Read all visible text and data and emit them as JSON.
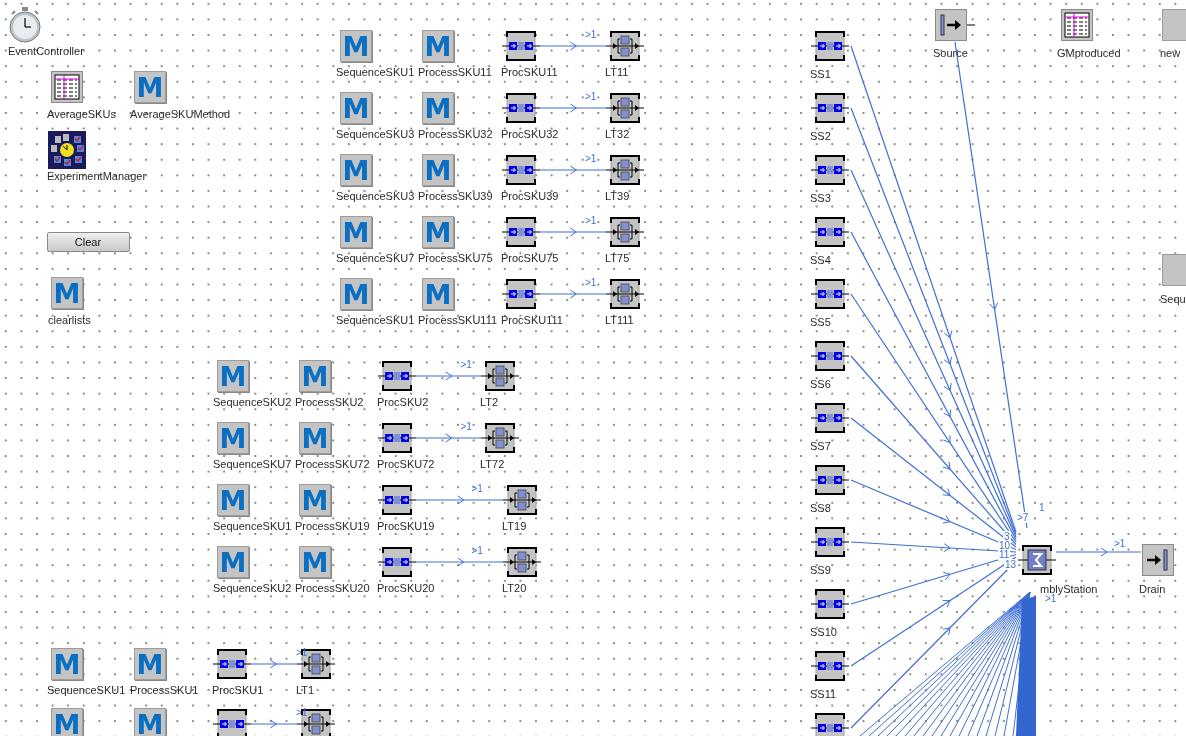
{
  "tools": [
    {
      "kind": "event_controller",
      "label": "EventController"
    },
    {
      "kind": "table",
      "label": "AverageSKUs"
    },
    {
      "kind": "method",
      "glyph": "M",
      "label": "AverageSKUMethod"
    },
    {
      "kind": "experiment_manager",
      "label": "ExperimentManager"
    },
    {
      "kind": "button",
      "label": "Clear"
    },
    {
      "kind": "method",
      "glyph": "M",
      "label": "clearlists"
    }
  ],
  "sku_blocks": [
    {
      "rows": [
        {
          "sequence_glyph": "M",
          "sequence_method": "SequenceSKU1",
          "process_glyph": "M",
          "process_method": "ProcessSKU11",
          "station": "ProcSKU11",
          "connector": ">1",
          "transfer": "LT11"
        },
        {
          "sequence_glyph": "M",
          "sequence_method": "SequenceSKU3",
          "process_glyph": "M",
          "process_method": "ProcessSKU32",
          "station": "ProcSKU32",
          "connector": ">1",
          "transfer": "LT32"
        },
        {
          "sequence_glyph": "M",
          "sequence_method": "SequenceSKU3",
          "process_glyph": "M",
          "process_method": "ProcessSKU39",
          "station": "ProcSKU39",
          "connector": ">1",
          "transfer": "LT39"
        },
        {
          "sequence_glyph": "M",
          "sequence_method": "SequenceSKU7",
          "process_glyph": "M",
          "process_method": "ProcessSKU75",
          "station": "ProcSKU75",
          "connector": ">1",
          "transfer": "LT75"
        },
        {
          "sequence_glyph": "M",
          "sequence_method": "SequenceSKU1",
          "process_glyph": "M",
          "process_method": "ProcessSKU111",
          "station": "ProcSKU111",
          "connector": ">1",
          "transfer": "LT111"
        }
      ]
    },
    {
      "rows": [
        {
          "sequence_glyph": "M",
          "sequence_method": "SequenceSKU2",
          "process_glyph": "M",
          "process_method": "ProcessSKU2",
          "station": "ProcSKU2",
          "connector": ">1",
          "transfer": "LT2"
        },
        {
          "sequence_glyph": "M",
          "sequence_method": "SequenceSKU7",
          "process_glyph": "M",
          "process_method": "ProcessSKU72",
          "station": "ProcSKU72",
          "connector": ">1",
          "transfer": "LT72"
        },
        {
          "sequence_glyph": "M",
          "sequence_method": "SequenceSKU1",
          "process_glyph": "M",
          "process_method": "ProcessSKU19",
          "station": "ProcSKU19",
          "connector": ">1",
          "transfer": "LT19"
        },
        {
          "sequence_glyph": "M",
          "sequence_method": "SequenceSKU2",
          "process_glyph": "M",
          "process_method": "ProcessSKU20",
          "station": "ProcSKU20",
          "connector": ">1",
          "transfer": "LT20"
        }
      ]
    },
    {
      "rows": [
        {
          "sequence_glyph": "M",
          "sequence_method": "SequenceSKU1",
          "process_glyph": "M",
          "process_method": "ProcessSKU1",
          "station": "ProcSKU1",
          "connector": ">1",
          "transfer": "LT1"
        },
        {
          "sequence_glyph": "M",
          "process_glyph": "M",
          "connector": ">1"
        }
      ]
    }
  ],
  "supply_stations": [
    {
      "kind": "station",
      "label": "SS1"
    },
    {
      "kind": "station",
      "label": "SS2"
    },
    {
      "kind": "station",
      "label": "SS3"
    },
    {
      "kind": "station",
      "label": "SS4"
    },
    {
      "kind": "station",
      "label": "SS5"
    },
    {
      "kind": "station",
      "label": "SS6"
    },
    {
      "kind": "station",
      "label": "SS7"
    },
    {
      "kind": "station",
      "label": "SS8"
    },
    {
      "kind": "station",
      "label": "SS9"
    },
    {
      "kind": "station",
      "label": "SS10"
    },
    {
      "kind": "station",
      "label": "SS11"
    },
    {
      "kind": "station"
    }
  ],
  "objects": [
    {
      "kind": "source",
      "label": "Source"
    },
    {
      "kind": "table",
      "label": "GMproduced"
    },
    {
      "kind": "method",
      "label": "new"
    },
    {
      "kind": "method",
      "label": "Sequ"
    }
  ],
  "assembly": {
    "label": "mblyStation",
    "port_labels": [
      ">7",
      "1",
      "3",
      "10",
      "11",
      "13",
      ">1"
    ]
  },
  "drain": {
    "label": "Drain",
    "connector": ">1"
  }
}
